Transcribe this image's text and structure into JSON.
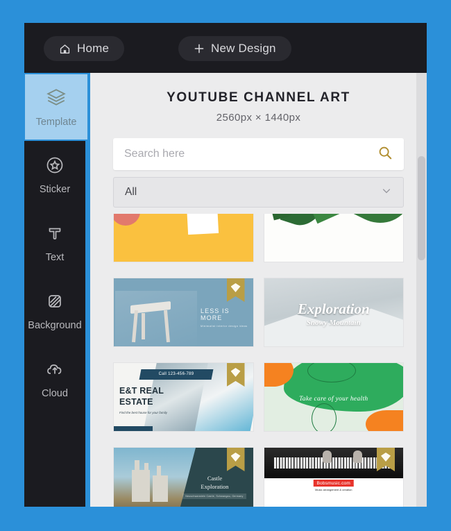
{
  "topbar": {
    "home_label": "Home",
    "home_icon": "home-icon",
    "new_design_label": "New Design",
    "new_design_icon": "plus-icon"
  },
  "sidebar": {
    "items": [
      {
        "label": "Template",
        "icon": "layers-icon",
        "active": true
      },
      {
        "label": "Sticker",
        "icon": "star-badge-icon",
        "active": false
      },
      {
        "label": "Text",
        "icon": "text-t-icon",
        "active": false
      },
      {
        "label": "Background",
        "icon": "hatch-square-icon",
        "active": false
      },
      {
        "label": "Cloud",
        "icon": "cloud-upload-icon",
        "active": false
      }
    ]
  },
  "panel": {
    "title": "YOUTUBE CHANNEL ART",
    "subtitle": "2560px × 1440px",
    "search": {
      "value": "",
      "placeholder": "Search here",
      "icon": "search-icon"
    },
    "filter": {
      "value": "All",
      "icon": "chevron-down-icon"
    }
  },
  "templates": [
    {
      "id": "yellow-abstract",
      "name": "Yellow Abstract",
      "premium": false,
      "badge_icon": ""
    },
    {
      "id": "green-leaves",
      "name": "Green Leaves",
      "premium": false,
      "badge_icon": ""
    },
    {
      "id": "less-is-more",
      "name": "Less Is More",
      "premium": true,
      "badge_icon": "premium-diamond-icon",
      "headline": "LESS IS MORE",
      "subline": "Minimalist interior design ideas"
    },
    {
      "id": "exploration-snow",
      "name": "Exploration Snowy Mountain",
      "premium": false,
      "badge_icon": "",
      "headline": "Exploration",
      "subline": "Snowy Mountain"
    },
    {
      "id": "real-estate",
      "name": "E&T Real Estate",
      "premium": true,
      "badge_icon": "premium-diamond-icon",
      "phone": "Call 123-456-789",
      "headline": "E&T REAL\nESTATE",
      "subline": "Find the best house for your family"
    },
    {
      "id": "health-care",
      "name": "Take Care Of Your Health",
      "premium": false,
      "badge_icon": "",
      "headline": "Take care of your health"
    },
    {
      "id": "castle",
      "name": "Castle Exploration",
      "premium": true,
      "badge_icon": "premium-diamond-icon",
      "headline": "Castle\nExploration",
      "subline": "Neuschwanstein Castle, Schwangau, Germany"
    },
    {
      "id": "piano-music",
      "name": "Bobsmusic",
      "premium": true,
      "badge_icon": "premium-diamond-icon",
      "headline": "Bobsmusic.com",
      "subline": "Music arrangement & creation"
    }
  ],
  "colors": {
    "page_background": "#2b90d9",
    "window_dark": "#1b1b20",
    "panel_background": "#ececed",
    "active_item": "#a5d0ef",
    "active_border": "#2b90d9",
    "search_icon": "#b08d2e",
    "premium_badge": "#b99e46"
  }
}
